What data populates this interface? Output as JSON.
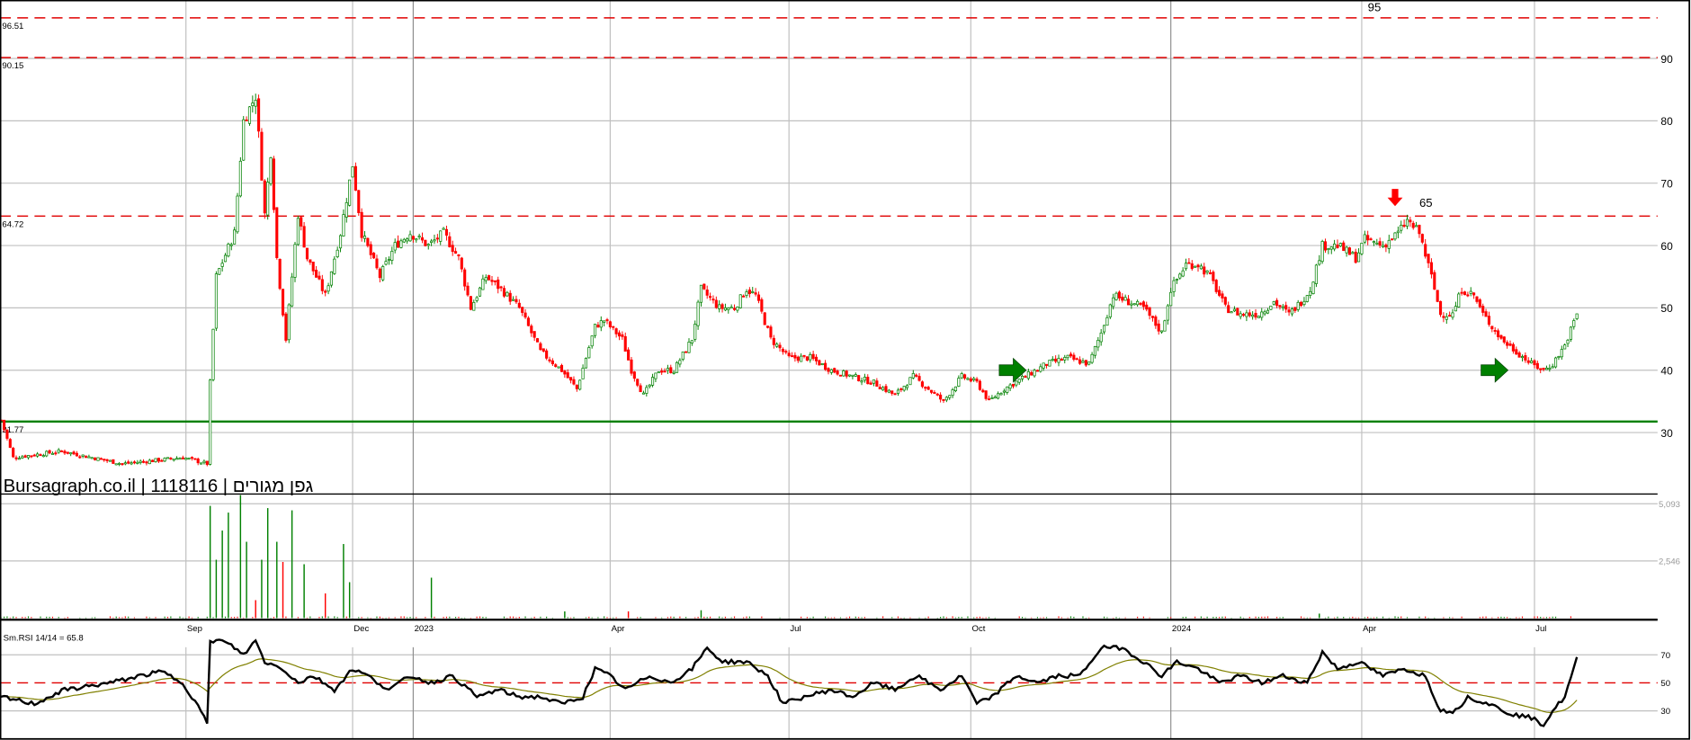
{
  "chart_data": {
    "type": "candlestick",
    "title": "Bursagraph.co.il | 1118116 | גפן מגורים",
    "x_unit": "trading days from start",
    "x_ticks": [
      {
        "day": 61,
        "label": "Sep",
        "year": false
      },
      {
        "day": 116,
        "label": "Dec",
        "year": false
      },
      {
        "day": 136,
        "label": "2023",
        "year": true
      },
      {
        "day": 201,
        "label": "Apr",
        "year": false
      },
      {
        "day": 260,
        "label": "Jul",
        "year": false
      },
      {
        "day": 320,
        "label": "Oct",
        "year": false
      },
      {
        "day": 386,
        "label": "2024",
        "year": true
      },
      {
        "day": 449,
        "label": "Apr",
        "year": false
      },
      {
        "day": 506,
        "label": "Jul",
        "year": false
      }
    ],
    "price_axis": {
      "ylim": [
        22,
        97
      ],
      "ticks": [
        "30",
        "40",
        "50",
        "60",
        "70",
        "80",
        "90"
      ],
      "grid": true
    },
    "price_close_samples": [
      [
        0,
        32
      ],
      [
        4,
        26
      ],
      [
        20,
        27
      ],
      [
        40,
        25
      ],
      [
        60,
        26
      ],
      [
        68,
        25
      ],
      [
        69,
        38
      ],
      [
        71,
        55
      ],
      [
        77,
        62
      ],
      [
        80,
        80
      ],
      [
        84,
        84
      ],
      [
        87,
        65
      ],
      [
        89,
        75
      ],
      [
        91,
        58
      ],
      [
        94,
        45
      ],
      [
        98,
        65
      ],
      [
        101,
        58
      ],
      [
        107,
        52
      ],
      [
        112,
        62
      ],
      [
        116,
        73
      ],
      [
        119,
        62
      ],
      [
        125,
        55
      ],
      [
        130,
        60
      ],
      [
        135,
        62
      ],
      [
        141,
        60
      ],
      [
        146,
        62
      ],
      [
        151,
        58
      ],
      [
        155,
        50
      ],
      [
        160,
        55
      ],
      [
        165,
        53
      ],
      [
        171,
        50
      ],
      [
        178,
        43
      ],
      [
        185,
        40
      ],
      [
        190,
        37
      ],
      [
        196,
        47
      ],
      [
        199,
        48
      ],
      [
        205,
        45
      ],
      [
        208,
        40
      ],
      [
        212,
        36
      ],
      [
        217,
        40
      ],
      [
        222,
        40
      ],
      [
        228,
        45
      ],
      [
        231,
        53
      ],
      [
        237,
        50
      ],
      [
        242,
        50
      ],
      [
        246,
        53
      ],
      [
        249,
        52
      ],
      [
        254,
        45
      ],
      [
        260,
        42
      ],
      [
        267,
        42
      ],
      [
        274,
        40
      ],
      [
        281,
        39
      ],
      [
        288,
        38
      ],
      [
        295,
        36
      ],
      [
        301,
        39
      ],
      [
        306,
        37
      ],
      [
        311,
        35
      ],
      [
        317,
        39
      ],
      [
        322,
        38
      ],
      [
        326,
        35
      ],
      [
        331,
        37
      ],
      [
        338,
        39
      ],
      [
        345,
        41
      ],
      [
        352,
        42
      ],
      [
        359,
        41
      ],
      [
        363,
        46
      ],
      [
        367,
        52
      ],
      [
        372,
        51
      ],
      [
        377,
        50
      ],
      [
        383,
        46
      ],
      [
        386,
        53
      ],
      [
        391,
        57
      ],
      [
        395,
        57
      ],
      [
        399,
        55
      ],
      [
        404,
        50
      ],
      [
        409,
        49
      ],
      [
        415,
        49
      ],
      [
        420,
        51
      ],
      [
        425,
        49
      ],
      [
        429,
        51
      ],
      [
        432,
        53
      ],
      [
        436,
        60
      ],
      [
        441,
        60
      ],
      [
        447,
        58
      ],
      [
        450,
        61
      ],
      [
        456,
        60
      ],
      [
        461,
        62
      ],
      [
        464,
        64
      ],
      [
        468,
        62
      ],
      [
        472,
        55
      ],
      [
        475,
        49
      ],
      [
        479,
        49
      ],
      [
        482,
        53
      ],
      [
        486,
        52
      ],
      [
        489,
        49
      ],
      [
        495,
        45
      ],
      [
        500,
        43
      ],
      [
        505,
        41
      ],
      [
        509,
        40
      ],
      [
        512,
        41
      ],
      [
        516,
        44
      ],
      [
        520,
        49
      ]
    ],
    "levels": [
      {
        "value": 96.51,
        "label": "96.51",
        "style": "dashed",
        "color": "#e00000"
      },
      {
        "value": 90.15,
        "label": "90.15",
        "style": "dashed",
        "color": "#e00000"
      },
      {
        "value": 64.72,
        "label": "64.72",
        "style": "dashed",
        "color": "#e00000"
      },
      {
        "value": 31.77,
        "label": "31.77",
        "style": "solid",
        "color": "#008000"
      }
    ],
    "annotations": [
      {
        "text": "95",
        "day": 451,
        "price": 97.6
      },
      {
        "text": "65",
        "day": 468,
        "price": 66.2
      }
    ],
    "signals": [
      {
        "type": "sell-arrow",
        "day": 460,
        "price": 67,
        "color": "#ff0000"
      },
      {
        "type": "buy-arrow",
        "day": 334,
        "price": 40,
        "color": "#008000"
      },
      {
        "type": "buy-arrow",
        "day": 493,
        "price": 40,
        "color": "#008000"
      }
    ],
    "volume_axis": {
      "ylim": [
        0,
        5600
      ],
      "ticks": [
        "5,093",
        "2,546"
      ],
      "tick_values": [
        5093,
        2546
      ]
    },
    "volume_spikes": [
      [
        69,
        5000,
        "up"
      ],
      [
        71,
        2600,
        "up"
      ],
      [
        73,
        3900,
        "up"
      ],
      [
        75,
        4700,
        "up"
      ],
      [
        79,
        5600,
        "up"
      ],
      [
        81,
        3400,
        "up"
      ],
      [
        84,
        800,
        "down"
      ],
      [
        86,
        2600,
        "up"
      ],
      [
        88,
        4900,
        "up"
      ],
      [
        91,
        3400,
        "up"
      ],
      [
        93,
        2500,
        "down"
      ],
      [
        96,
        4800,
        "up"
      ],
      [
        100,
        2400,
        "up"
      ],
      [
        107,
        1100,
        "down"
      ],
      [
        113,
        3300,
        "up"
      ],
      [
        115,
        1600,
        "up"
      ],
      [
        142,
        1800,
        "up"
      ],
      [
        186,
        300,
        "up"
      ],
      [
        207,
        300,
        "down"
      ],
      [
        231,
        350,
        "up"
      ],
      [
        435,
        200,
        "up"
      ]
    ],
    "rsi": {
      "label": "Sm.RSI 14/14 = 65.8",
      "ylim": [
        15,
        78
      ],
      "ticks": [
        "70",
        "50",
        "30"
      ],
      "tick_values": [
        70,
        50,
        30
      ],
      "samples": [
        [
          0,
          40
        ],
        [
          11,
          35
        ],
        [
          21,
          45
        ],
        [
          36,
          50
        ],
        [
          46,
          55
        ],
        [
          53,
          58
        ],
        [
          60,
          50
        ],
        [
          66,
          30
        ],
        [
          68,
          20
        ],
        [
          69,
          80
        ],
        [
          73,
          80
        ],
        [
          77,
          75
        ],
        [
          80,
          70
        ],
        [
          84,
          80
        ],
        [
          87,
          65
        ],
        [
          93,
          60
        ],
        [
          98,
          50
        ],
        [
          103,
          55
        ],
        [
          110,
          45
        ],
        [
          116,
          60
        ],
        [
          121,
          55
        ],
        [
          128,
          45
        ],
        [
          135,
          55
        ],
        [
          142,
          50
        ],
        [
          149,
          55
        ],
        [
          157,
          40
        ],
        [
          164,
          45
        ],
        [
          171,
          40
        ],
        [
          178,
          40
        ],
        [
          185,
          35
        ],
        [
          192,
          40
        ],
        [
          196,
          60
        ],
        [
          201,
          55
        ],
        [
          206,
          45
        ],
        [
          214,
          55
        ],
        [
          221,
          50
        ],
        [
          228,
          60
        ],
        [
          233,
          75
        ],
        [
          238,
          65
        ],
        [
          246,
          65
        ],
        [
          253,
          55
        ],
        [
          258,
          35
        ],
        [
          265,
          40
        ],
        [
          274,
          45
        ],
        [
          281,
          40
        ],
        [
          288,
          50
        ],
        [
          295,
          45
        ],
        [
          302,
          55
        ],
        [
          310,
          45
        ],
        [
          317,
          55
        ],
        [
          322,
          35
        ],
        [
          327,
          40
        ],
        [
          335,
          55
        ],
        [
          342,
          50
        ],
        [
          349,
          55
        ],
        [
          356,
          55
        ],
        [
          363,
          75
        ],
        [
          370,
          75
        ],
        [
          377,
          65
        ],
        [
          383,
          55
        ],
        [
          388,
          65
        ],
        [
          395,
          60
        ],
        [
          402,
          50
        ],
        [
          409,
          55
        ],
        [
          416,
          50
        ],
        [
          423,
          55
        ],
        [
          431,
          50
        ],
        [
          436,
          72
        ],
        [
          441,
          60
        ],
        [
          448,
          65
        ],
        [
          456,
          55
        ],
        [
          463,
          60
        ],
        [
          470,
          55
        ],
        [
          475,
          30
        ],
        [
          480,
          30
        ],
        [
          484,
          40
        ],
        [
          491,
          35
        ],
        [
          498,
          28
        ],
        [
          505,
          25
        ],
        [
          509,
          20
        ],
        [
          512,
          30
        ],
        [
          516,
          40
        ],
        [
          520,
          67
        ]
      ]
    },
    "colors": {
      "up": "#008000",
      "down": "#ff0000",
      "rsi": "#000000",
      "rsi_signal": "#808000",
      "grid": "#c0c0c0",
      "year_grid": "#909090"
    }
  }
}
